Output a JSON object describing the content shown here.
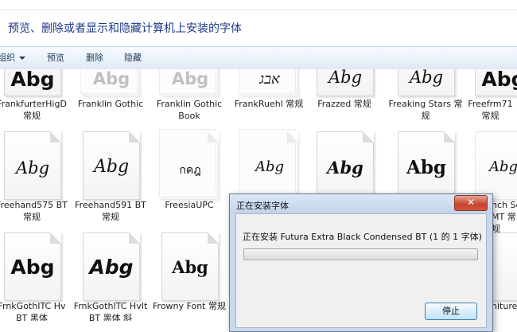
{
  "window": {
    "description": "预览、删除或者显示和隐藏计算机上安装的字体"
  },
  "toolbar": {
    "organize_label": "组织",
    "preview_label": "预览",
    "delete_label": "删除",
    "hide_label": "隐藏"
  },
  "fonts": {
    "top_row": [
      {
        "name": "FrankfurterHigD 常规",
        "glyph": "Abg"
      },
      {
        "name": "Franklin Gothic",
        "glyph": "Abg"
      },
      {
        "name": "Franklin Gothic Book",
        "glyph": "Abg"
      },
      {
        "name": "FrankRuehl 常规",
        "glyph": "אבג"
      },
      {
        "name": "Frazzed 常规",
        "glyph": "Abg"
      },
      {
        "name": "Freaking Stars 常规",
        "glyph": "Abg"
      },
      {
        "name": "Freefrm71 常规",
        "glyph": "Abg"
      }
    ],
    "middle_row": [
      {
        "name": "Freehand575 BT 常规",
        "glyph": "Abg"
      },
      {
        "name": "Freehand591 BT 常规",
        "glyph": "Abg"
      },
      {
        "name": "FreesiaUPC",
        "glyph": "กคฎ"
      },
      {
        "name": "",
        "glyph": "Abg"
      },
      {
        "name": "",
        "glyph": "Abg"
      },
      {
        "name": "",
        "glyph": "Abg"
      },
      {
        "name": "nch Sc MT 常规",
        "glyph": "Abg"
      }
    ],
    "bottom_row": [
      {
        "name": "FrnkGothITC Hv BT 黑体",
        "glyph": "Abg"
      },
      {
        "name": "FrnkGothITC HvIt BT 黑体 斜",
        "glyph": "Abg"
      },
      {
        "name": "Frowny Font 常规",
        "glyph": "Abg"
      },
      {
        "name": "niture",
        "glyph": ""
      }
    ]
  },
  "dialog": {
    "title": "正在安装字体",
    "close_label": "✕",
    "status": "正在安装 Futura Extra Black Condensed BT (1 的 1 字体)",
    "progress": 0,
    "stop_label": "停止"
  }
}
